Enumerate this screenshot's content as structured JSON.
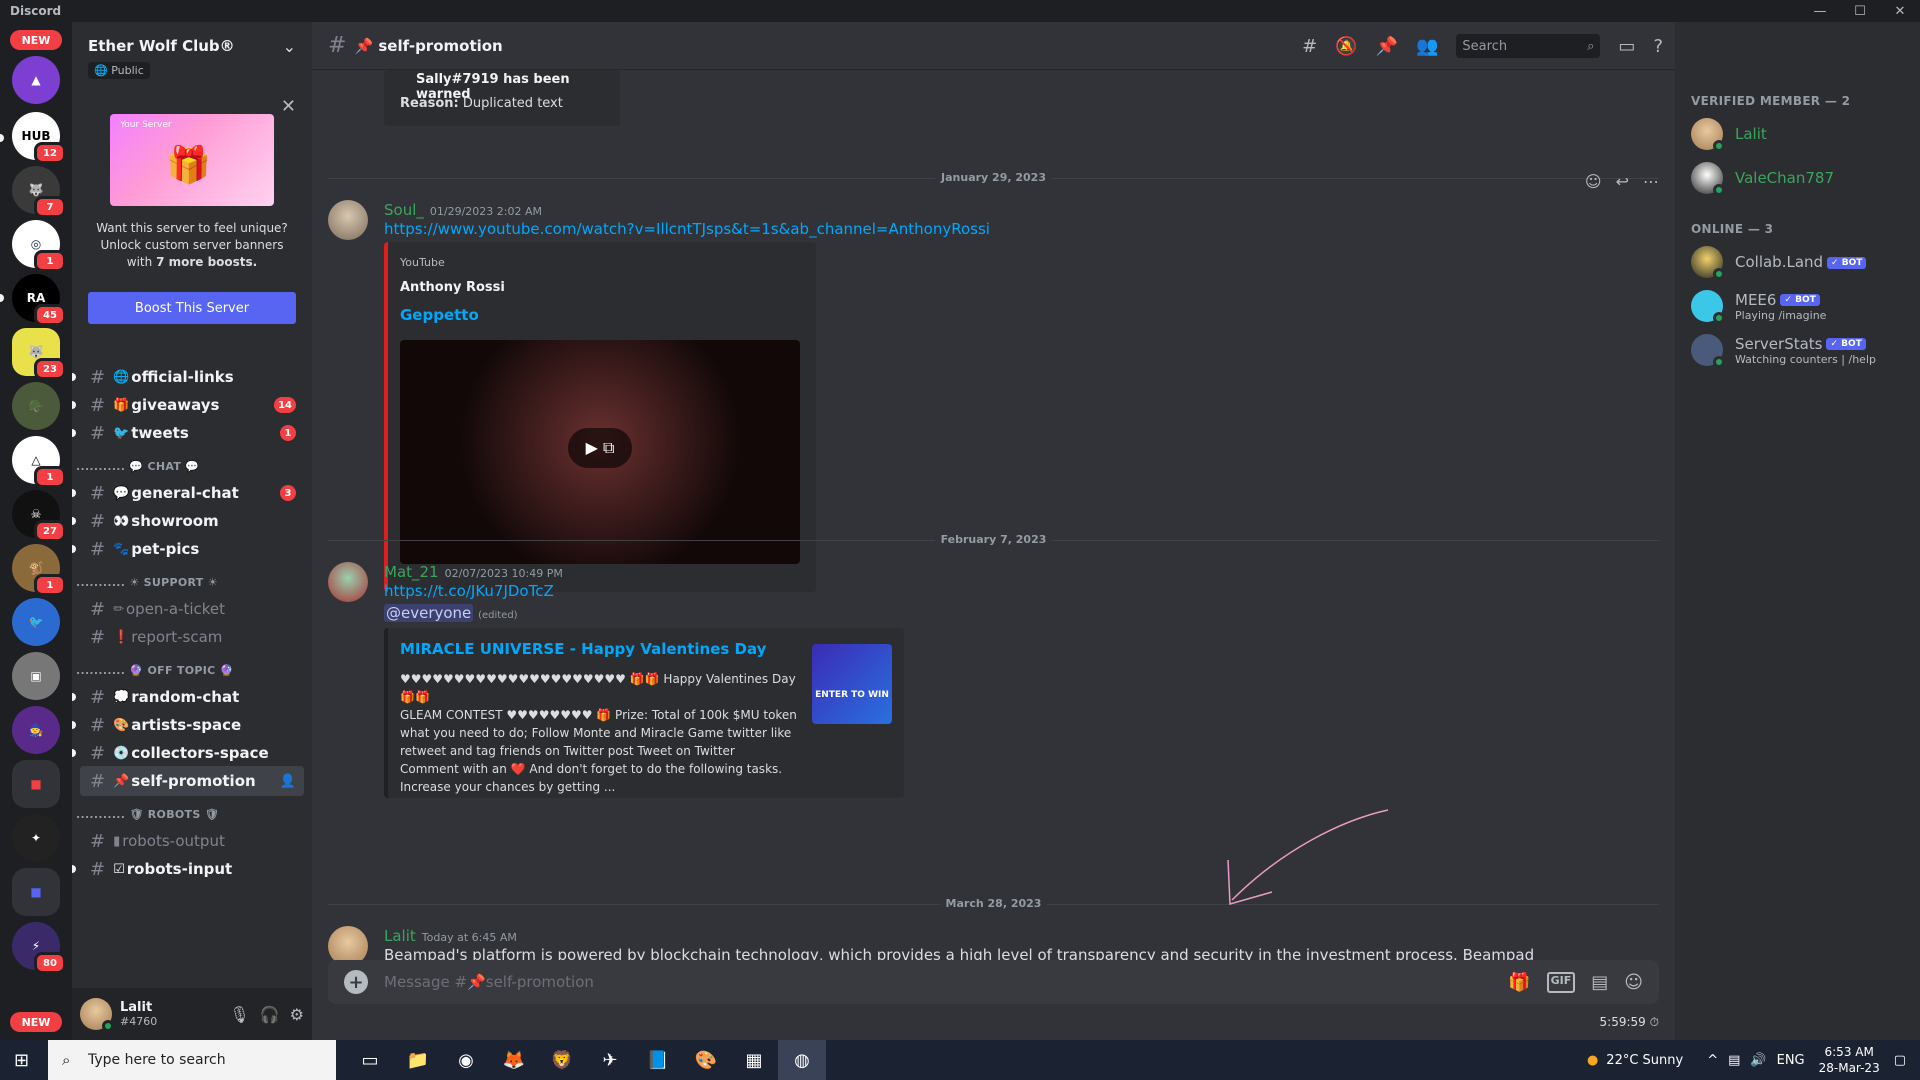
{
  "app_title": "Discord",
  "server_rail": {
    "new_top": "NEW",
    "new_bottom": "NEW",
    "badges": [
      "12",
      "7",
      "1",
      "45",
      "23",
      "1",
      "27",
      "1",
      "80"
    ],
    "labels": [
      "HUB",
      "RA"
    ]
  },
  "guild": {
    "name": "Ether Wolf Club®",
    "visibility": "Public",
    "boost": {
      "art_title": "Your Server",
      "text_line1": "Want this server to feel unique?",
      "text_line2": "Unlock custom server banners",
      "text_line3_prefix": "with",
      "text_line3_bold": "7 more boosts.",
      "button": "Boost This Server"
    }
  },
  "channels": [
    {
      "emoji": "🌐",
      "name": "official-links",
      "badge": ""
    },
    {
      "emoji": "🎁",
      "name": "giveaways",
      "badge": "14"
    },
    {
      "emoji": "🐦",
      "name": "tweets",
      "badge": "1"
    },
    {
      "emoji": "💬",
      "name": "general-chat",
      "badge": "3"
    },
    {
      "emoji": "👀",
      "name": "showroom",
      "badge": ""
    },
    {
      "emoji": "🐾",
      "name": "pet-pics",
      "badge": ""
    },
    {
      "emoji": "✏",
      "name": "open-a-ticket",
      "badge": ""
    },
    {
      "emoji": "❗",
      "name": "report-scam",
      "badge": ""
    },
    {
      "emoji": "💭",
      "name": "random-chat",
      "badge": ""
    },
    {
      "emoji": "🎨",
      "name": "artists-space",
      "badge": ""
    },
    {
      "emoji": "💿",
      "name": "collectors-space",
      "badge": ""
    },
    {
      "emoji": "📌",
      "name": "self-promotion",
      "badge": ""
    },
    {
      "emoji": "▮",
      "name": "robots-output",
      "badge": ""
    },
    {
      "emoji": "☑",
      "name": "robots-input",
      "badge": ""
    }
  ],
  "categories": {
    "chat": "........... 💬 CHAT 💬",
    "support": "........... ☀ SUPPORT ☀",
    "offtopic": "........... 🔮 OFF TOPIC 🔮",
    "robots": "........... 🛡 ROBOTS 🛡"
  },
  "user": {
    "name": "Lalit",
    "tag": "#4760"
  },
  "channel_header": {
    "title": "📌 self-promotion",
    "search_placeholder": "Search"
  },
  "messages": {
    "warn_embed": {
      "line1": "Sally#7919 has been warned",
      "reason_label": "Reason:",
      "reason": "Duplicated text"
    },
    "date1": "January 29, 2023",
    "soul": {
      "author": "Soul_",
      "timestamp": "01/29/2023 2:02 AM",
      "link": "https://www.youtube.com/watch?v=IllcntTJsps&t=1s&ab_channel=AnthonyRossi",
      "provider": "YouTube",
      "channel": "Anthony Rossi",
      "video_title": "Geppetto"
    },
    "date2": "February 7, 2023",
    "mat": {
      "author": "Mat_21",
      "timestamp": "02/07/2023 10:49 PM",
      "link": "https://t.co/JKu7JDoTcZ",
      "mention": "@everyone",
      "edited": "(edited)",
      "embed_title": "MIRACLE UNIVERSE -  Happy Valentines Day",
      "embed_body_l1": "♥♥♥♥♥♥♥♥♥♥♥♥♥♥♥♥♥♥♥♥♥ 🎁🎁 Happy Valentines Day 🎁🎁",
      "embed_body_l2": "GLEAM CONTEST ♥♥♥♥♥♥♥♥ 🎁 Prize: Total of 100k $MU token",
      "embed_body_l3": "what you need to do; Follow Monte and Miracle Game twitter like",
      "embed_body_l4": "retweet and tag friends on Twitter post Tweet on Twitter",
      "embed_body_l5": "Comment with an ❤️ And don't forget to do the following tasks.",
      "embed_body_l6": "Increase your chances by getting ...",
      "thumb_text": "ENTER TO WIN"
    },
    "date3": "March 28, 2023",
    "lalit": {
      "author": "Lalit",
      "timestamp": "Today at 6:45 AM",
      "text": "Beampad's platform is powered by blockchain technology, which provides a high level of transparency and security in the investment process. Beampad"
    }
  },
  "composer": {
    "placeholder": "Message #📌self-promotion",
    "gif": "GIF",
    "timer": "5:59:59"
  },
  "members": {
    "verified_header": "VERIFIED MEMBER — 2",
    "online_header": "ONLINE — 3",
    "verified": [
      {
        "name": "Lalit",
        "color": "#3ba55c"
      },
      {
        "name": "ValeChan787",
        "color": "#3ba55c"
      }
    ],
    "online": [
      {
        "name": "Collab.Land",
        "bot": "✓ BOT",
        "activity": ""
      },
      {
        "name": "MEE6",
        "bot": "✓ BOT",
        "activity": "Playing /imagine"
      },
      {
        "name": "ServerStats",
        "bot": "✓ BOT",
        "activity": "Watching counters | /help"
      }
    ]
  },
  "taskbar": {
    "search_placeholder": "Type here to search",
    "weather": "22°C  Sunny",
    "lang": "ENG",
    "time": "6:53 AM",
    "date": "28-Mar-23"
  }
}
